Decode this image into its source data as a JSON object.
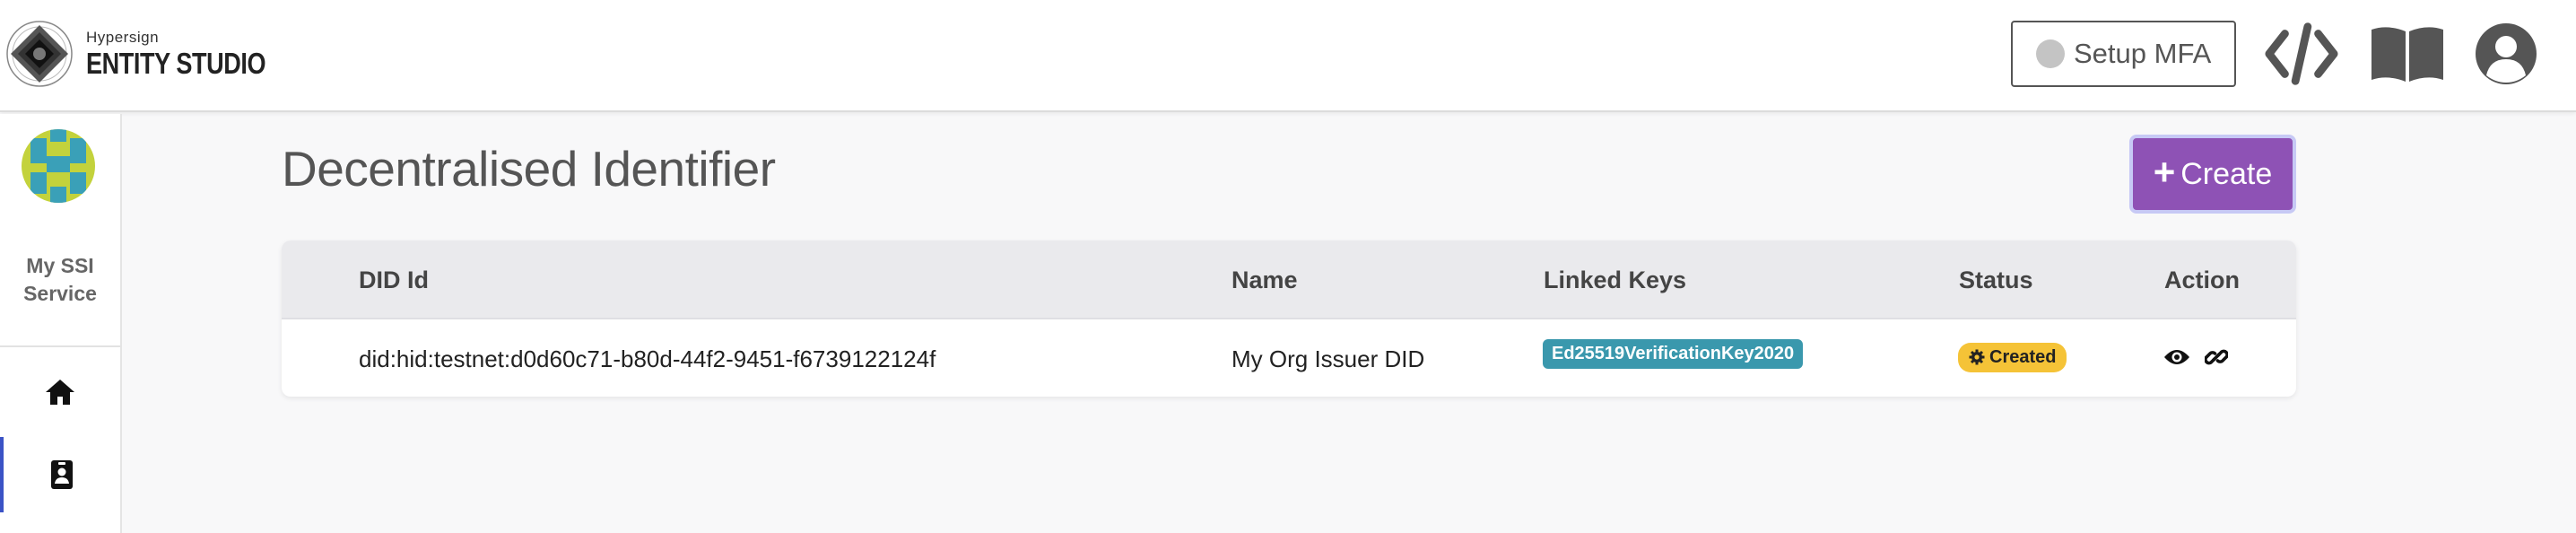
{
  "brand": {
    "subtitle": "Hypersign",
    "title": "ENTITY STUDIO",
    "logo_icon": "hypersign-logo-icon"
  },
  "header": {
    "mfa_button": {
      "label": "Setup MFA",
      "status_color": "#c4c4c4"
    },
    "icons": [
      "code-icon",
      "book-icon",
      "user-avatar-icon"
    ]
  },
  "sidebar": {
    "org_name": "My SSI Service",
    "items": [
      {
        "name": "home",
        "icon": "home-icon",
        "active": false
      },
      {
        "name": "did",
        "icon": "id-badge-icon",
        "active": true
      }
    ]
  },
  "page": {
    "title": "Decentralised Identifier",
    "create_button": {
      "label": "Create",
      "icon": "plus-icon",
      "color": "#8e52b5"
    }
  },
  "table": {
    "columns": [
      "DID Id",
      "Name",
      "Linked Keys",
      "Status",
      "Action"
    ],
    "rows": [
      {
        "did_id": "did:hid:testnet:d0d60c71-b80d-44f2-9451-f6739122124f",
        "name": "My Org Issuer DID",
        "linked_key": "Ed25519VerificationKey2020",
        "status": "Created",
        "actions": [
          "eye-icon",
          "link-icon"
        ]
      }
    ]
  },
  "colors": {
    "key_badge": "#3a98ad",
    "status_badge": "#f5c337",
    "active_indicator": "#3b53c6"
  }
}
